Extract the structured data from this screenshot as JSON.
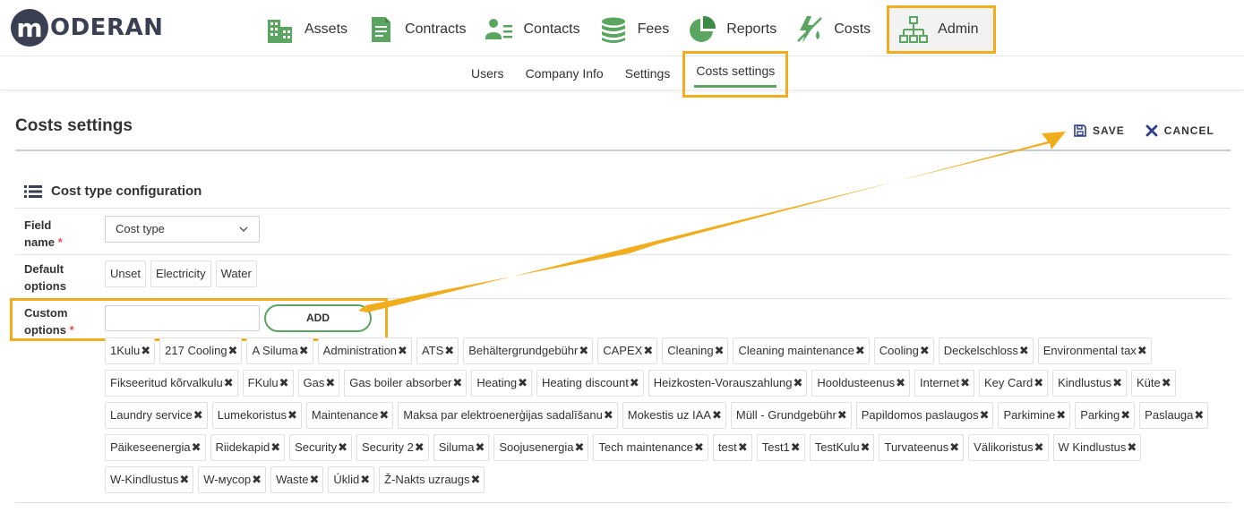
{
  "brand": {
    "logo_letter": "m",
    "logo_text": "ODERAN"
  },
  "nav": [
    {
      "label": "Assets",
      "icon": "building-icon"
    },
    {
      "label": "Contracts",
      "icon": "document-icon"
    },
    {
      "label": "Contacts",
      "icon": "contacts-icon"
    },
    {
      "label": "Fees",
      "icon": "coins-icon"
    },
    {
      "label": "Reports",
      "icon": "pie-chart-icon"
    },
    {
      "label": "Costs",
      "icon": "costs-icon"
    },
    {
      "label": "Admin",
      "icon": "org-chart-icon",
      "active": true
    }
  ],
  "subnav": [
    {
      "label": "Users"
    },
    {
      "label": "Company Info"
    },
    {
      "label": "Settings"
    },
    {
      "label": "Costs settings",
      "active": true
    }
  ],
  "page": {
    "title": "Costs settings",
    "save_label": "SAVE",
    "cancel_label": "CANCEL"
  },
  "section": {
    "title": "Cost type configuration",
    "field_name_label_1": "Field",
    "field_name_label_2": "name",
    "field_select_value": "Cost type",
    "default_options_label_1": "Default",
    "default_options_label_2": "options",
    "default_options": [
      "Unset",
      "Electricity",
      "Water"
    ],
    "custom_options_label_1": "Custom",
    "custom_options_label_2": "options",
    "required_mark": "*",
    "custom_input_value": "",
    "add_label": "ADD"
  },
  "custom_options": [
    "1Kulu",
    "217 Cooling",
    "A Siluma",
    "Administration",
    "ATS",
    "Behältergrundgebühr",
    "CAPEX",
    "Cleaning",
    "Cleaning maintenance",
    "Cooling",
    "Deckelschloss",
    "Environmental tax",
    "Fikseeritud kõrvalkulu",
    "FKulu",
    "Gas",
    "Gas boiler absorber",
    "Heating",
    "Heating discount",
    "Heizkosten-Vorauszahlung",
    "Hooldusteenus",
    "Internet",
    "Key Card",
    "Kindlustus",
    "Küte",
    "Laundry service",
    "Lumekoristus",
    "Maintenance",
    "Maksa par elektroenerģijas sadalīšanu",
    "Mokestis uz IAA",
    "Müll - Grundgebühr",
    "Papildomos paslaugos",
    "Parkimine",
    "Parking",
    "Paslauga",
    "Päikeseenergia",
    "Riidekapid",
    "Security",
    "Security 2",
    "Siluma",
    "Soojusenergia",
    "Tech maintenance",
    "test",
    "Test1",
    "TestKulu",
    "Turvateenus",
    "Välikoristus",
    "W Kindlustus",
    "W-Kindlustus",
    "W-мусор",
    "Waste",
    "Úklid",
    "Ž-Nakts uzraugs"
  ],
  "colors": {
    "accent_green": "#5aa661",
    "highlight_orange": "#f0ad1e",
    "brand_dark": "#3b3f52",
    "cancel_blue": "#2c3e8c"
  }
}
